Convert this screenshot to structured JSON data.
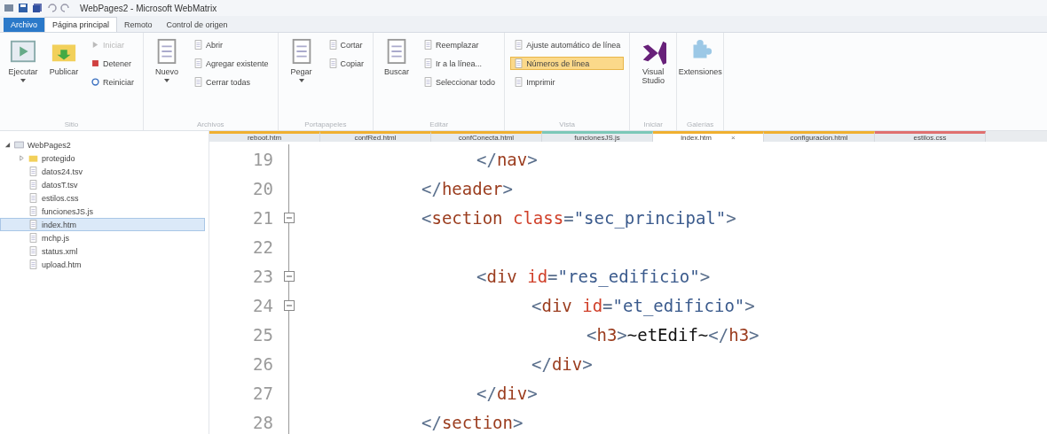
{
  "window": {
    "title": "WebPages2 - Microsoft WebMatrix"
  },
  "ribbon_tabs": [
    {
      "label": "Archivo",
      "kind": "file"
    },
    {
      "label": "Página principal",
      "kind": "tab",
      "selected": true
    },
    {
      "label": "Remoto",
      "kind": "tab",
      "selected": false
    },
    {
      "label": "Control de origen",
      "kind": "tab",
      "selected": false
    }
  ],
  "ribbon_groups": [
    {
      "label": "Sitio",
      "items": [
        {
          "kind": "large",
          "label": "Ejecutar",
          "dropdown": true,
          "disabled": false
        },
        {
          "kind": "large",
          "label": "Publicar",
          "dropdown": false,
          "disabled": false
        },
        {
          "kind": "small",
          "label": "Iniciar",
          "disabled": true,
          "selected": false
        },
        {
          "kind": "small",
          "label": "Detener",
          "disabled": false,
          "selected": false
        },
        {
          "kind": "small",
          "label": "Reiniciar",
          "disabled": false,
          "selected": false
        }
      ]
    },
    {
      "label": "Archivos",
      "items": [
        {
          "kind": "large",
          "label": "Nuevo",
          "dropdown": true,
          "disabled": false
        },
        {
          "kind": "small",
          "label": "Abrir",
          "disabled": false,
          "selected": false
        },
        {
          "kind": "small",
          "label": "Agregar existente",
          "disabled": false,
          "selected": false
        },
        {
          "kind": "small",
          "label": "Cerrar todas",
          "disabled": false,
          "selected": false
        }
      ]
    },
    {
      "label": "Portapapeles",
      "items": [
        {
          "kind": "large",
          "label": "Pegar",
          "dropdown": true,
          "disabled": false
        },
        {
          "kind": "small",
          "label": "Cortar",
          "disabled": false,
          "selected": false
        },
        {
          "kind": "small",
          "label": "Copiar",
          "disabled": false,
          "selected": false
        }
      ]
    },
    {
      "label": "Editar",
      "items": [
        {
          "kind": "large",
          "label": "Buscar",
          "dropdown": false,
          "disabled": false
        },
        {
          "kind": "small",
          "label": "Reemplazar",
          "disabled": false,
          "selected": false
        },
        {
          "kind": "small",
          "label": "Ir a la línea...",
          "disabled": false,
          "selected": false
        },
        {
          "kind": "small",
          "label": "Seleccionar todo",
          "disabled": false,
          "selected": false
        }
      ]
    },
    {
      "label": "Vista",
      "items": [
        {
          "kind": "small",
          "label": "Ajuste automático de línea",
          "disabled": false,
          "selected": false
        },
        {
          "kind": "small",
          "label": "Números de línea",
          "disabled": false,
          "selected": true
        },
        {
          "kind": "small",
          "label": "Imprimir",
          "disabled": false,
          "selected": false
        }
      ]
    },
    {
      "label": "Iniciar",
      "items": [
        {
          "kind": "large",
          "label": "Visual Studio",
          "dropdown": false,
          "disabled": false
        }
      ]
    },
    {
      "label": "Galerías",
      "items": [
        {
          "kind": "large",
          "label": "Extensiones",
          "dropdown": false,
          "disabled": false
        }
      ]
    }
  ],
  "sidebar": {
    "items": [
      {
        "label": "WebPages2",
        "kind": "site",
        "expanded": true,
        "selected": false,
        "children": [
          {
            "label": "protegido",
            "kind": "folder",
            "expanded": false,
            "selected": false
          },
          {
            "label": "datos24.tsv",
            "kind": "file",
            "selected": false
          },
          {
            "label": "datosT.tsv",
            "kind": "file",
            "selected": false
          },
          {
            "label": "estilos.css",
            "kind": "file",
            "selected": false
          },
          {
            "label": "funcionesJS.js",
            "kind": "file",
            "selected": false
          },
          {
            "label": "index.htm",
            "kind": "file",
            "selected": true
          },
          {
            "label": "mchp.js",
            "kind": "file",
            "selected": false
          },
          {
            "label": "status.xml",
            "kind": "file",
            "selected": false
          },
          {
            "label": "upload.htm",
            "kind": "file",
            "selected": false
          }
        ]
      }
    ]
  },
  "editor_tabs": [
    {
      "label": "reboot.htm",
      "selected": false,
      "color": "#f0b030"
    },
    {
      "label": "confRed.html",
      "selected": false,
      "color": "#f0b030"
    },
    {
      "label": "confConecta.html",
      "selected": false,
      "color": "#f0b030"
    },
    {
      "label": "funcionesJS.js",
      "selected": false,
      "color": "#7cc8b8"
    },
    {
      "label": "index.htm",
      "selected": true,
      "color": "#f0b030",
      "close": "×"
    },
    {
      "label": "configuracion.html",
      "selected": false,
      "color": "#f0b030"
    },
    {
      "label": "estilos.css",
      "selected": false,
      "color": "#e07070"
    }
  ],
  "code_lines": [
    {
      "children": [
        {
          "number": "19",
          "tokens": [
            {
              "kind": "punct",
              "text": "</"
            },
            {
              "kind": "tag",
              "text": "nav"
            },
            {
              "kind": "punct",
              "text": ">"
            }
          ]
        }
      ]
    },
    {
      "number": "20",
      "tokens": [
        {
          "kind": "punct",
          "text": "</"
        },
        {
          "kind": "tag",
          "text": "header"
        },
        {
          "kind": "punct",
          "text": ">"
        }
      ]
    },
    {
      "number": "21",
      "expanded": true,
      "tokens": [
        {
          "kind": "punct",
          "text": "<"
        },
        {
          "kind": "tag",
          "text": "section"
        },
        {
          "kind": "attr",
          "text": " class"
        },
        {
          "kind": "punct",
          "text": "="
        },
        {
          "kind": "value",
          "text": "\"sec_principal\""
        },
        {
          "kind": "punct",
          "text": ">"
        }
      ],
      "children": [
        {
          "number": "22"
        },
        {
          "number": "23",
          "expanded": true,
          "tokens": [
            {
              "kind": "punct",
              "text": "<"
            },
            {
              "kind": "tag",
              "text": "div"
            },
            {
              "kind": "attr",
              "text": " id"
            },
            {
              "kind": "punct",
              "text": "="
            },
            {
              "kind": "value",
              "text": "\"res_edificio\""
            },
            {
              "kind": "punct",
              "text": ">"
            }
          ],
          "children": [
            {
              "number": "24",
              "expanded": true,
              "tokens": [
                {
                  "kind": "punct",
                  "text": "<"
                },
                {
                  "kind": "tag",
                  "text": "div"
                },
                {
                  "kind": "attr",
                  "text": " id"
                },
                {
                  "kind": "punct",
                  "text": "="
                },
                {
                  "kind": "value",
                  "text": "\"et_edificio\""
                },
                {
                  "kind": "punct",
                  "text": ">"
                }
              ],
              "children": [
                {
                  "number": "25",
                  "tokens": [
                    {
                      "kind": "punct",
                      "text": "<"
                    },
                    {
                      "kind": "tag",
                      "text": "h3"
                    },
                    {
                      "kind": "punct",
                      "text": ">"
                    },
                    {
                      "kind": "text",
                      "text": "~etEdif~"
                    },
                    {
                      "kind": "punct",
                      "text": "</"
                    },
                    {
                      "kind": "tag",
                      "text": "h3"
                    },
                    {
                      "kind": "punct",
                      "text": ">"
                    }
                  ]
                }
              ]
            },
            {
              "number": "26",
              "tokens": [
                {
                  "kind": "punct",
                  "text": "</"
                },
                {
                  "kind": "tag",
                  "text": "div"
                },
                {
                  "kind": "punct",
                  "text": ">"
                }
              ]
            }
          ]
        },
        {
          "number": "27",
          "tokens": [
            {
              "kind": "punct",
              "text": "</"
            },
            {
              "kind": "tag",
              "text": "div"
            },
            {
              "kind": "punct",
              "text": ">"
            }
          ]
        }
      ]
    },
    {
      "number": "28",
      "tokens": [
        {
          "kind": "punct",
          "text": "</"
        },
        {
          "kind": "tag",
          "text": "section"
        },
        {
          "kind": "punct",
          "text": ">"
        }
      ]
    }
  ]
}
